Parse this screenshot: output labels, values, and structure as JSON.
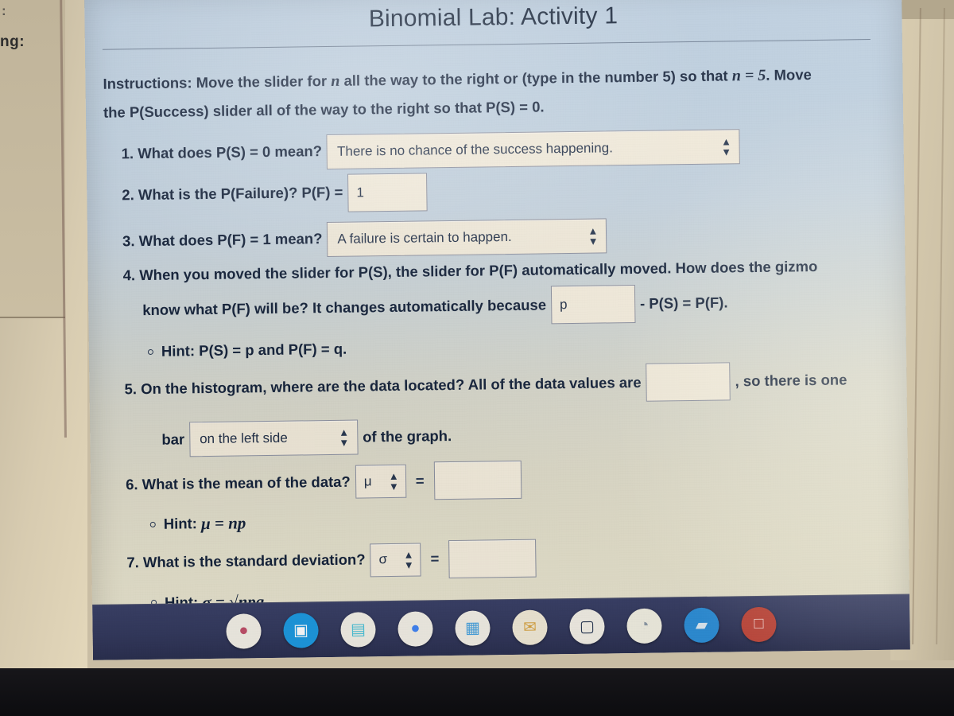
{
  "environment": {
    "background_left_note_top": ":",
    "background_left_note": "ng:",
    "cursor": "arrow-cursor"
  },
  "document": {
    "title": "Binomial Lab: Activity 1",
    "instructions": {
      "label": "Instructions:",
      "part1_a": " Move the slider for ",
      "part1_n": "n",
      "part1_b": " all the way to the right or (type in the number 5) so that ",
      "part1_eq": "n = 5",
      "part1_c": ". Move",
      "part2": "the P(Success) slider all of the way to the right so that P(S) = 0."
    },
    "questions": [
      {
        "number": "1.",
        "prompt": "What does P(S) = 0 mean?",
        "control": "dropdown",
        "value": "There is no chance of the success happening."
      },
      {
        "number": "2.",
        "prompt": "What is the P(Failure)? P(F) =",
        "control": "textbox",
        "value": "1"
      },
      {
        "number": "3.",
        "prompt": "What does P(F) = 1 mean?",
        "control": "dropdown",
        "value": "A failure is certain to happen."
      },
      {
        "number": "4.",
        "prompt_line1": "When you moved the slider for P(S), the slider for P(F) automatically moved. How does the gizmo",
        "prompt_line2_a": "know what P(F) will be? It changes automatically because",
        "control": "textbox",
        "value": "p",
        "prompt_line2_b": "- P(S) = P(F)."
      },
      {
        "number": "5.",
        "prompt_a": "On the histogram, where are the data located? All of the data values are",
        "control_1": "textbox",
        "value_1": "",
        "prompt_b": ", so there is one",
        "prompt_c": "bar",
        "control_2": "dropdown",
        "value_2": "on the left side",
        "prompt_d": "of the graph."
      },
      {
        "number": "6.",
        "prompt": "What is the mean of the data?",
        "symbol": "μ",
        "equals": "=",
        "control": "textbox",
        "value": ""
      },
      {
        "number": "7.",
        "prompt": "What is the standard deviation?",
        "symbol": "σ",
        "equals": "=",
        "control": "textbox",
        "value": ""
      }
    ],
    "hints": [
      {
        "label": "Hint:",
        "text": "P(S) = p and P(F) = q."
      },
      {
        "label": "Hint:",
        "text": "μ = np"
      },
      {
        "label": "Hint:",
        "text": "σ = √npq"
      }
    ]
  },
  "shelf": {
    "items": [
      {
        "name": "launcher-icon",
        "glyph": "●",
        "bg": "#f2efe6",
        "fg": "#c0506a",
        "open": false
      },
      {
        "name": "camera-icon",
        "glyph": "▣",
        "bg": "#1e9ae0",
        "fg": "#ffffff",
        "open": false
      },
      {
        "name": "calculator-icon",
        "glyph": "▤",
        "bg": "#f2efe6",
        "fg": "#4fc3d9",
        "open": false
      },
      {
        "name": "chrome-icon",
        "glyph": "●",
        "bg": "#f2efe6",
        "fg": "#4285f4",
        "open": true
      },
      {
        "name": "slides-icon",
        "glyph": "▦",
        "bg": "#f2efe6",
        "fg": "#4aa3df",
        "open": false
      },
      {
        "name": "gmail-icon",
        "glyph": "✉",
        "bg": "#f1ead7",
        "fg": "#d9a441",
        "open": false
      },
      {
        "name": "classroom-icon",
        "glyph": "▢",
        "bg": "#f2efe6",
        "fg": "#2b3a55",
        "open": true
      },
      {
        "name": "clock-icon",
        "glyph": "◔",
        "bg": "#f1efe2",
        "fg": "#8d9aa6",
        "open": true
      },
      {
        "name": "files-icon",
        "glyph": "▰",
        "bg": "#2e8fd8",
        "fg": "#ddeaf3",
        "open": true
      },
      {
        "name": "photos-icon",
        "glyph": "□",
        "bg": "#c0483c",
        "fg": "#f7d9d4",
        "open": true
      }
    ]
  },
  "colors": {
    "screen_top": "#b9cbdd",
    "screen_bottom": "#eae5cf",
    "text": "#16243c",
    "field_bg": "#f3ecdc",
    "field_border": "#8e93a3",
    "shelf_bg": "#343a5e"
  }
}
